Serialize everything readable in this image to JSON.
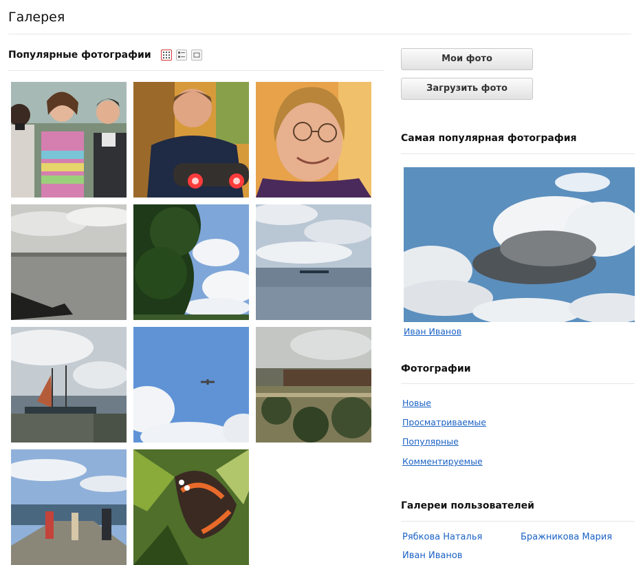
{
  "page": {
    "title": "Галерея"
  },
  "popular": {
    "title": "Популярные фотографии",
    "view_icons": [
      "grid-view-icon",
      "list-view-icon",
      "single-view-icon"
    ],
    "photos": [
      {
        "desc": "people-photo"
      },
      {
        "desc": "man-with-binoculars"
      },
      {
        "desc": "man-with-glasses"
      },
      {
        "desc": "sea-cloudy"
      },
      {
        "desc": "tree-sky"
      },
      {
        "desc": "sea-boat"
      },
      {
        "desc": "harbor-boats"
      },
      {
        "desc": "plane-sky"
      },
      {
        "desc": "fortress"
      },
      {
        "desc": "pier-people"
      },
      {
        "desc": "butterfly"
      }
    ]
  },
  "buttons": {
    "my_photos": "Мои фото",
    "upload_photo": "Загрузить фото"
  },
  "most_popular": {
    "title": "Самая популярная фотография",
    "author": "Иван Иванов"
  },
  "photos_section": {
    "title": "Фотографии",
    "links": [
      "Новые",
      "Просматриваемые",
      "Популярные",
      "Комментируемые"
    ]
  },
  "user_galleries": {
    "title": "Галереи пользователей",
    "users": [
      "Рябкова Наталья",
      "Бражникова Мария",
      "Иван Иванов"
    ]
  },
  "colors": {
    "link": "#1a62c4",
    "active_icon_border": "#dd3333"
  }
}
